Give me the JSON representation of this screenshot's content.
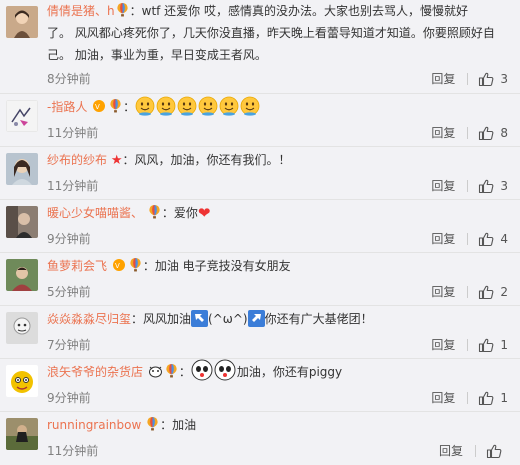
{
  "comments": [
    {
      "username": "倩倩是猪、h",
      "text_line1": "wtf    还爱你  哎，感情真的没办法。大家也别去骂人，慢慢就好",
      "text_line2": "了。  风风都心疼死你了，几天你没直播，昨天晚上看蕾导知道才知道。你要照顾好自",
      "text_line3": "己。 加油，事业为重，早日变成王者风。",
      "time": "8分钟前",
      "reply": "回复",
      "likes": "3"
    },
    {
      "username": "-指路人",
      "text": "",
      "time": "11分钟前",
      "reply": "回复",
      "likes": "8"
    },
    {
      "username": "纱布的纱布",
      "text": "风风，加油，你还有我们。！",
      "time": "11分钟前",
      "reply": "回复",
      "likes": "3"
    },
    {
      "username": "暖心少女喵喵酱、",
      "text": "爱你",
      "time": "9分钟前",
      "reply": "回复",
      "likes": "4"
    },
    {
      "username": "鱼萝莉会飞",
      "text": "加油 电子竞技没有女朋友",
      "time": "5分钟前",
      "reply": "回复",
      "likes": "2"
    },
    {
      "username": "焱焱淼淼尽归玺",
      "text_a": "风风加油",
      "text_b": "(^ω^)",
      "text_c": "你还有广大基佬团！",
      "time": "7分钟前",
      "reply": "回复",
      "likes": "1"
    },
    {
      "username": "浪矢爷爷的杂货店",
      "text": "加油，你还有piggy",
      "time": "9分钟前",
      "reply": "回复",
      "likes": "1"
    },
    {
      "username": "runningrainbow",
      "text": "加油",
      "time": "11分钟前",
      "reply": "回复",
      "likes": ""
    }
  ],
  "icons": {
    "like": "thumbs-up-icon",
    "badge": "hot-air-balloon-icon",
    "emoji": "smile-face-icon",
    "heart": "heart-icon",
    "star": "star-icon",
    "arrow_up_left": "arrow-up-left-icon",
    "arrow_up_right": "arrow-up-right-icon"
  },
  "colors": {
    "username": "#eb7350",
    "text": "#333333",
    "time": "#808080",
    "background": "#f2f2f5"
  }
}
